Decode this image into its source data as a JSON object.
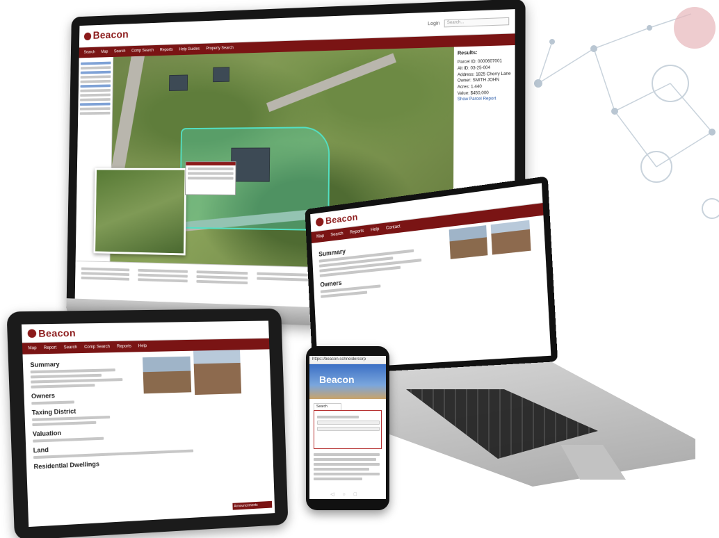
{
  "brand": {
    "logo_text": "Beacon",
    "accent": "#8b1a1a",
    "nav_bg": "#7a1414"
  },
  "monitor": {
    "nav_items": [
      "Search",
      "Map",
      "Search",
      "Comp Search",
      "Reports",
      "Help Guides",
      "Property Search"
    ],
    "login_label": "Login",
    "search_placeholder": "Search...",
    "results": {
      "title": "Results:",
      "lines": [
        "Parcel ID: 0000607001",
        "Alt ID: 03-25-004",
        "Address: 1825 Cherry Lane",
        "Owner: SMITH JOHN",
        "Acres: 1.440",
        "Value: $450,000"
      ],
      "link": "Show Parcel Report"
    }
  },
  "laptop": {
    "nav_items": [
      "Map",
      "Search",
      "Reports",
      "Help",
      "Contact"
    ],
    "section_title": "Summary",
    "owners_title": "Owners"
  },
  "tablet": {
    "nav_items": [
      "Map",
      "Report",
      "Search",
      "Comp Search",
      "Reports",
      "Help"
    ],
    "section_title": "Summary",
    "owners_title": "Owners",
    "taxing_title": "Taxing District",
    "valuation_title": "Valuation",
    "land_title": "Land",
    "dwellings_title": "Residential Dwellings",
    "announcements": "Announcements"
  },
  "phone": {
    "url": "https://beacon.schneidercorp",
    "logo_text": "Beacon",
    "tab_label": "Search"
  }
}
